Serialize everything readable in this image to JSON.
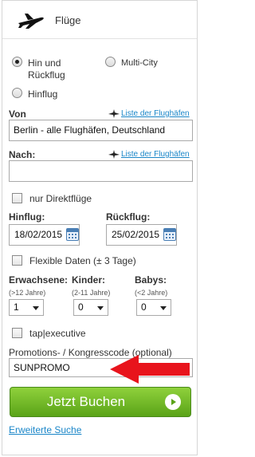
{
  "header": {
    "title": "Flüge",
    "icon": "airplane-icon"
  },
  "trip_type": {
    "options": [
      "Hin und Rückflug",
      "Multi-City",
      "Hinflug"
    ],
    "selected": "Hin und Rückflug",
    "round_trip_line1": "Hin und",
    "round_trip_line2": "Rückflug",
    "multi_city": "Multi-City",
    "one_way": "Hinflug"
  },
  "from": {
    "label": "Von",
    "value": "Berlin - alle Flughäfen, Deutschland",
    "airport_list_link": "Liste der Flughäfen"
  },
  "to": {
    "label": "Nach:",
    "value": "",
    "airport_list_link": "Liste der Flughäfen"
  },
  "direct_flights": {
    "label": "nur Direktflüge",
    "checked": false
  },
  "departure": {
    "label": "Hinflug:",
    "value": "18/02/2015"
  },
  "return": {
    "label": "Rückflug:",
    "value": "25/02/2015"
  },
  "flexible_dates": {
    "label": "Flexible Daten (± 3 Tage)",
    "checked": false
  },
  "passengers": {
    "adults": {
      "label": "Erwachsene:",
      "sub": "(>12 Jahre)",
      "value": "1"
    },
    "children": {
      "label": "Kinder:",
      "sub": "(2-11 Jahre)",
      "value": "0"
    },
    "babies": {
      "label": "Babys:",
      "sub": "(<2 Jahre)",
      "value": "0"
    }
  },
  "tap_executive": {
    "label": "tap|executive",
    "checked": false
  },
  "promo": {
    "label": "Promotions- / Kongresscode (optional)",
    "value": "SUNPROMO"
  },
  "submit": {
    "label": "Jetzt Buchen"
  },
  "advanced_search": {
    "label": "Erweiterte Suche"
  },
  "colors": {
    "link": "#1a86c8",
    "cta_green": "#6bb826",
    "annotation_red": "#e8141c"
  }
}
